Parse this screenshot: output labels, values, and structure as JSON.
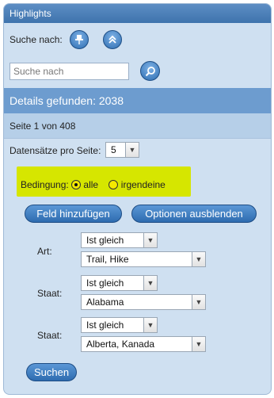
{
  "panel": {
    "title": "Highlights",
    "search_label": "Suche nach:",
    "pin_icon": "pin-icon",
    "collapse_icon": "chevron-up-icon",
    "search_placeholder": "Suche nach",
    "search_icon": "magnifier-icon",
    "details_found": "Details gefunden: 2038",
    "page_info": "Seite 1 von 408",
    "records_label": "Datensätze pro Seite:",
    "records_value": "5"
  },
  "condition": {
    "label": "Bedingung:",
    "options": [
      {
        "label": "alle",
        "checked": true
      },
      {
        "label": "irgendeine",
        "checked": false
      }
    ],
    "highlight_color": "#d6e600"
  },
  "actions": {
    "add_field": "Feld hinzufügen",
    "hide_options": "Optionen ausblenden",
    "search": "Suchen"
  },
  "filters": [
    {
      "label": "Art:",
      "operator": "Ist gleich",
      "value": "Trail, Hike"
    },
    {
      "label": "Staat:",
      "operator": "Ist gleich",
      "value": "Alabama"
    },
    {
      "label": "Staat:",
      "operator": "Ist gleich",
      "value": "Alberta, Kanada"
    }
  ],
  "colors": {
    "titlebar": "#3e73ad",
    "panel_bg": "#cfe0f1",
    "band_dark": "#6d9ccf",
    "band_mid": "#b6cfe8",
    "button": "#2e6cb0"
  }
}
